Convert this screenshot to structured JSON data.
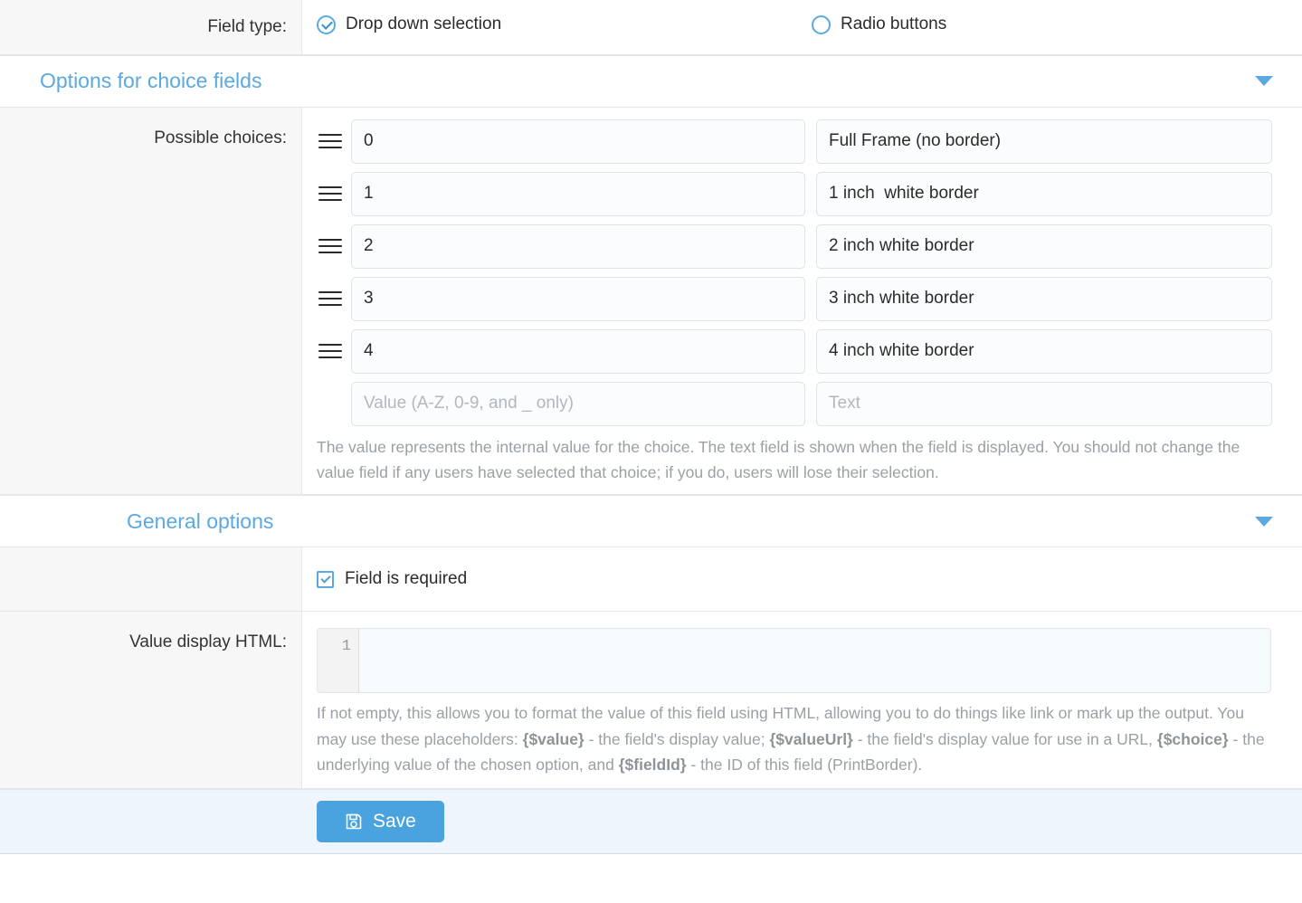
{
  "field_type": {
    "label": "Field type:",
    "options": [
      {
        "label": "Drop down selection",
        "selected": true
      },
      {
        "label": "Radio buttons",
        "selected": false
      }
    ]
  },
  "sections": {
    "choices": {
      "title": "Options for choice fields",
      "collapse_icon": "chevron-down-icon"
    },
    "general": {
      "title": "General options",
      "collapse_icon": "chevron-down-icon"
    }
  },
  "choices": {
    "label": "Possible choices:",
    "drag_icon": "drag-handle-icon",
    "rows": [
      {
        "value": "0",
        "text": "Full Frame (no border)"
      },
      {
        "value": "1",
        "text": "1 inch  white border"
      },
      {
        "value": "2",
        "text": "2 inch white border"
      },
      {
        "value": "3",
        "text": "3 inch white border"
      },
      {
        "value": "4",
        "text": "4 inch white border"
      }
    ],
    "new_row": {
      "value": "",
      "text": "",
      "value_placeholder": "Value (A-Z, 0-9, and _ only)",
      "text_placeholder": "Text"
    },
    "help": "The value represents the internal value for the choice. The text field is shown when the field is displayed. You should not change the value field if any users have selected that choice; if you do, users will lose their selection."
  },
  "required": {
    "label": "Field is required",
    "checked": true
  },
  "value_display_html": {
    "label": "Value display HTML:",
    "line_number": "1",
    "content": "",
    "help_parts": [
      {
        "text": "If not empty, this allows you to format the value of this field using HTML, allowing you to do things like link or mark up the output. You may use these placeholders: ",
        "bold": false
      },
      {
        "text": "{$value}",
        "bold": true
      },
      {
        "text": " - the field's display value; ",
        "bold": false
      },
      {
        "text": "{$valueUrl}",
        "bold": true
      },
      {
        "text": " - the field's display value for use in a URL, ",
        "bold": false
      },
      {
        "text": "{$choice}",
        "bold": true
      },
      {
        "text": " - the underlying value of the chosen option, and ",
        "bold": false
      },
      {
        "text": "{$fieldId}",
        "bold": true
      },
      {
        "text": " - the ID of this field (PrintBorder).",
        "bold": false
      }
    ]
  },
  "footer": {
    "save_label": "Save",
    "save_icon": "floppy-disk-icon"
  },
  "colors": {
    "accent": "#5aa9df",
    "save_button": "#4aa3df",
    "label_background": "#f7f7f7",
    "footer_background": "#eef5fc",
    "help_text": "#9aa0a6"
  }
}
